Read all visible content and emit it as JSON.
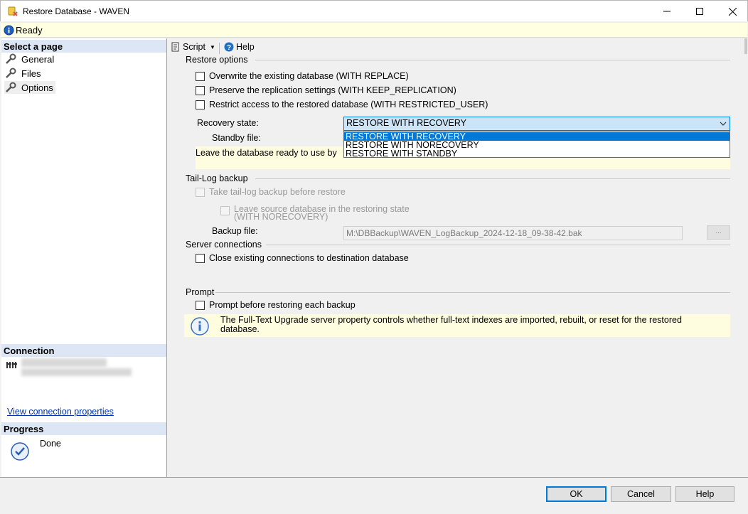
{
  "window": {
    "title": "Restore Database - WAVEN",
    "minimize_label": "—",
    "maximize_label": "☐",
    "close_label": "✕"
  },
  "status": {
    "text": "Ready",
    "icon": "info-icon"
  },
  "left_pane": {
    "select_page_header": "Select a page",
    "pages": [
      {
        "label": "General",
        "icon": "wrench-icon"
      },
      {
        "label": "Files",
        "icon": "wrench-icon"
      },
      {
        "label": "Options",
        "icon": "wrench-icon",
        "selected": true
      }
    ],
    "connection_header": "Connection",
    "connection_link": "View connection properties",
    "progress_header": "Progress",
    "progress_status": "Done"
  },
  "toolbar": {
    "script_label": "Script",
    "help_label": "Help"
  },
  "restore_options": {
    "header": "Restore options",
    "overwrite_label": "Overwrite the existing database (WITH REPLACE)",
    "preserve_label": "Preserve the replication settings (WITH KEEP_REPLICATION)",
    "restrict_label": "Restrict access to the restored database (WITH RESTRICTED_USER)",
    "recovery_state_label": "Recovery state:",
    "recovery_state_value": "RESTORE WITH RECOVERY",
    "recovery_options": [
      "RESTORE WITH RECOVERY",
      "RESTORE WITH NORECOVERY",
      "RESTORE WITH STANDBY"
    ],
    "standby_file_label": "Standby file:",
    "ready_note": "Leave the database ready to use by"
  },
  "tail_log": {
    "header": "Tail-Log backup",
    "take_tail_label": "Take tail-log backup before restore",
    "leave_source_label": "Leave source database in the restoring state",
    "leave_source_label2": "(WITH NORECOVERY)",
    "backup_file_label": "Backup file:",
    "backup_file_value": "M:\\DBBackup\\WAVEN_LogBackup_2024-12-18_09-38-42.bak",
    "browse_label": "..."
  },
  "server_connections": {
    "header": "Server connections",
    "close_existing_label": "Close existing connections to destination database"
  },
  "prompt": {
    "header": "Prompt",
    "prompt_label": "Prompt before restoring each backup",
    "info_text": "The Full-Text Upgrade server property controls whether full-text indexes are imported, rebuilt, or reset for the restored database."
  },
  "buttons": {
    "ok": "OK",
    "cancel": "Cancel",
    "help": "Help"
  }
}
